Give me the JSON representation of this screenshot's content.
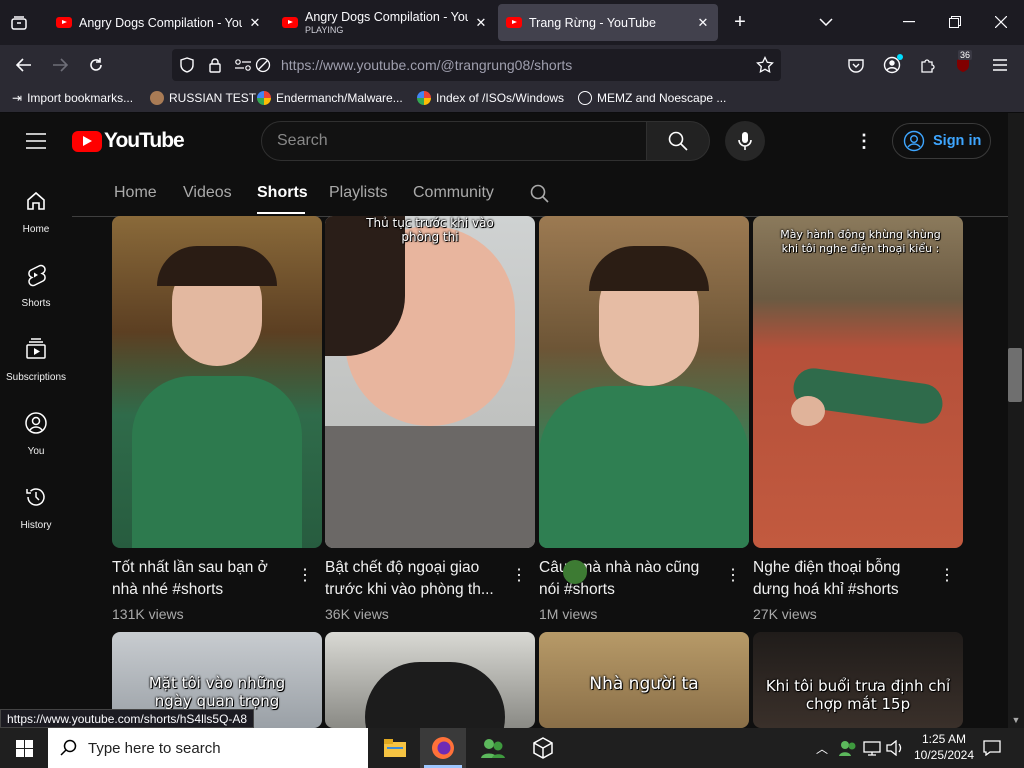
{
  "browser": {
    "tabs": [
      {
        "title": "Angry Dogs Compilation - YouTube",
        "sub": ""
      },
      {
        "title": "Angry Dogs Compilation - YouTube",
        "sub": "PLAYING"
      },
      {
        "title": "Trang Rừng - YouTube",
        "sub": ""
      }
    ],
    "url": "https://www.youtube.com/@trangrung08/shorts",
    "extension_badge": "36",
    "bookmarks": [
      "Import bookmarks...",
      "RUSSIAN TEST",
      "Endermanch/Malware...",
      "Index of /ISOs/Windows",
      "MEMZ and Noescape ..."
    ],
    "status_url": "https://www.youtube.com/shorts/hS4lls5Q-A8"
  },
  "youtube": {
    "logo": "YouTube",
    "search_placeholder": "Search",
    "signin": "Sign in",
    "sidebar": [
      {
        "label": "Home",
        "icon": "home-icon"
      },
      {
        "label": "Shorts",
        "icon": "shorts-icon"
      },
      {
        "label": "Subscriptions",
        "icon": "subscriptions-icon"
      },
      {
        "label": "You",
        "icon": "you-icon"
      },
      {
        "label": "History",
        "icon": "history-icon"
      }
    ],
    "channel_tabs": [
      "Home",
      "Videos",
      "Shorts",
      "Playlists",
      "Community"
    ],
    "active_tab": "Shorts",
    "shorts": [
      {
        "overlay": "",
        "title": "Tốt nhất lần sau bạn ở nhà nhé #shorts",
        "views": "131K views"
      },
      {
        "overlay": "Thủ tục trước khi vào phòng thi",
        "title": "Bật chết độ ngoại giao trước khi vào phòng th...",
        "views": "36K views"
      },
      {
        "overlay": "",
        "title": "Câu   i mà nhà nào cũng nói #shorts",
        "views": "1M views"
      },
      {
        "overlay": "Mày hành động khùng khùng khi tôi nghe điện thoại kiểu :",
        "title": "Nghe điện thoại bỗng dưng hoá khỉ #shorts",
        "views": "27K views"
      }
    ],
    "shorts_row2_overlays": [
      "Mặt tôi vào những ngày quan trọng",
      "",
      "Nhà người ta",
      "Khi tôi buổi trưa định chỉ chợp mắt 15p"
    ]
  },
  "taskbar": {
    "search_placeholder": "Type here to search",
    "time": "1:25 AM",
    "date": "10/25/2024"
  },
  "colors": {
    "yt_red": "#ff0000",
    "link_blue": "#3ea6ff",
    "bg": "#0f0f0f"
  }
}
